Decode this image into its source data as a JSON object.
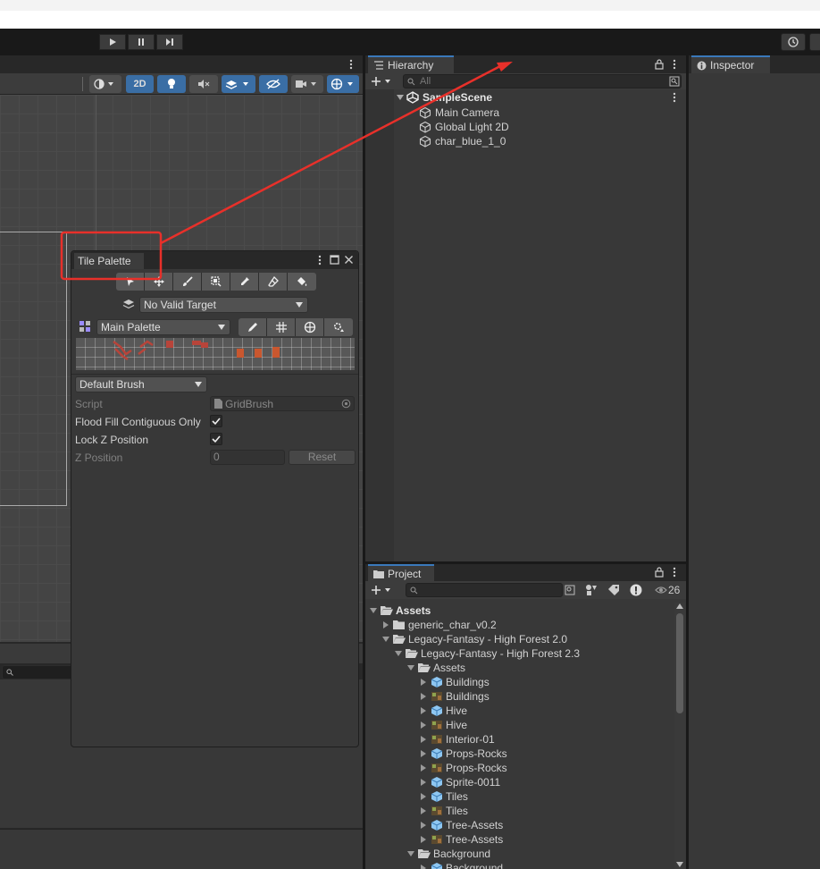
{
  "hierarchy": {
    "tab_label": "Hierarchy",
    "search_placeholder": "All",
    "scene_name": "SampleScene",
    "items": [
      "Main Camera",
      "Global Light 2D",
      "char_blue_1_0"
    ]
  },
  "inspector": {
    "tab_label": "Inspector"
  },
  "project": {
    "tab_label": "Project",
    "visible_count": "26",
    "tree": [
      {
        "label": "Assets",
        "depth": 0,
        "kind": "folder-open",
        "expand": "down",
        "bold": true
      },
      {
        "label": "generic_char_v0.2",
        "depth": 1,
        "kind": "folder",
        "expand": "right"
      },
      {
        "label": "Legacy-Fantasy - High Forest 2.0",
        "depth": 1,
        "kind": "folder-open",
        "expand": "down"
      },
      {
        "label": "Legacy-Fantasy - High Forest 2.3",
        "depth": 2,
        "kind": "folder-open",
        "expand": "down"
      },
      {
        "label": "Assets",
        "depth": 3,
        "kind": "folder-open",
        "expand": "down"
      },
      {
        "label": "Buildings",
        "depth": 4,
        "kind": "prefab",
        "expand": "right"
      },
      {
        "label": "Buildings",
        "depth": 4,
        "kind": "sprite",
        "expand": "right"
      },
      {
        "label": "Hive",
        "depth": 4,
        "kind": "prefab",
        "expand": "right"
      },
      {
        "label": "Hive",
        "depth": 4,
        "kind": "sprite",
        "expand": "right"
      },
      {
        "label": "Interior-01",
        "depth": 4,
        "kind": "sprite",
        "expand": "right"
      },
      {
        "label": "Props-Rocks",
        "depth": 4,
        "kind": "prefab",
        "expand": "right"
      },
      {
        "label": "Props-Rocks",
        "depth": 4,
        "kind": "sprite",
        "expand": "right"
      },
      {
        "label": "Sprite-0011",
        "depth": 4,
        "kind": "prefab",
        "expand": "right"
      },
      {
        "label": "Tiles",
        "depth": 4,
        "kind": "prefab",
        "expand": "right"
      },
      {
        "label": "Tiles",
        "depth": 4,
        "kind": "sprite",
        "expand": "right"
      },
      {
        "label": "Tree-Assets",
        "depth": 4,
        "kind": "prefab",
        "expand": "right"
      },
      {
        "label": "Tree-Assets",
        "depth": 4,
        "kind": "sprite",
        "expand": "right"
      },
      {
        "label": "Background",
        "depth": 3,
        "kind": "folder-open",
        "expand": "down"
      },
      {
        "label": "Background",
        "depth": 4,
        "kind": "prefab",
        "expand": "right"
      }
    ]
  },
  "scene_toolbar": {
    "mode_2d_label": "2D"
  },
  "tile_palette": {
    "title": "Tile Palette",
    "target_label": "No Valid Target",
    "palette_label": "Main Palette",
    "brush_label": "Default Brush",
    "script_label": "Script",
    "script_value": "GridBrush",
    "flood_fill_label": "Flood Fill Contiguous Only",
    "flood_fill_checked": true,
    "lock_z_label": "Lock Z Position",
    "lock_z_checked": true,
    "z_position_label": "Z Position",
    "z_position_value": "0",
    "reset_label": "Reset"
  },
  "annotation": {
    "color": "#e8302a"
  }
}
